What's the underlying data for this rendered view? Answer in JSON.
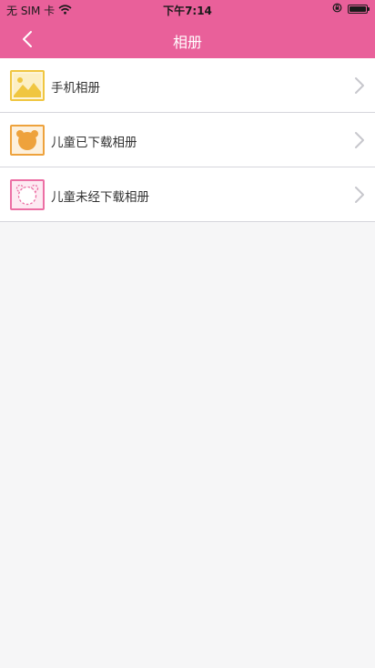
{
  "status_bar": {
    "carrier": "无 SIM 卡",
    "time": "下午7:14"
  },
  "nav": {
    "title": "相册",
    "back_icon": "chevron-left-icon"
  },
  "albums": [
    {
      "label": "手机相册",
      "icon": "landscape-photo-icon",
      "color": "#f0c640"
    },
    {
      "label": "儿童已下载相册",
      "icon": "alarm-clock-filled-icon",
      "color": "#eea23c"
    },
    {
      "label": "儿童未经下载相册",
      "icon": "alarm-clock-outline-icon",
      "color": "#ec6fa4"
    }
  ],
  "colors": {
    "header": "#e9609a",
    "background": "#f6f6f7",
    "divider": "#d6d6dc",
    "chevron": "#c7c7cc"
  }
}
